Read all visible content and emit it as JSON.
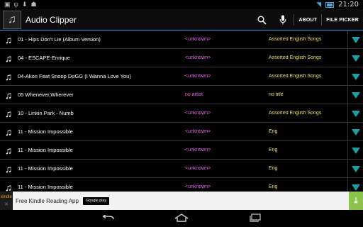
{
  "status": {
    "time": "21:20"
  },
  "app": {
    "title": "Audio Clipper"
  },
  "toolbar": {
    "about_label": "ABOUT",
    "file_picker_label": "FILE PICKER"
  },
  "songs": [
    {
      "title": "01 - Hips Don't Lie (Album Version)",
      "artist": "<unknown>",
      "album": "Assorted English Songs"
    },
    {
      "title": "04 - ESCAPE-Enrique",
      "artist": "<unknown>",
      "album": "Assorted English Songs"
    },
    {
      "title": "04-Akon Feat Snoop DoGG (I Wanna Love You)",
      "artist": "<unknown>",
      "album": "Assorted English Songs"
    },
    {
      "title": "05 Whenever,Wherever",
      "artist": "no artist",
      "album": "no title"
    },
    {
      "title": "10 - Linkin Park - Numb",
      "artist": "<unknown>",
      "album": "Assorted English Songs"
    },
    {
      "title": "11 - Mission Impossible",
      "artist": "<unknown>",
      "album": "Eng"
    },
    {
      "title": "11 - Mission Impossible",
      "artist": "<unknown>",
      "album": "Eng"
    },
    {
      "title": "11 - Mission Impossible",
      "artist": "<unknown>",
      "album": "Eng"
    },
    {
      "title": "11 - Mission Impossible",
      "artist": "<unknown>",
      "album": "Eng"
    }
  ],
  "ad": {
    "logo_text": "kindle",
    "text": "Free Kindle Reading App",
    "store_badge": "Google play"
  },
  "icons": {
    "song": "music-note-icon",
    "download": "download-triangle-icon"
  },
  "colors": {
    "accent": "#2a9fd6",
    "artist": "#ee66ee",
    "album": "#f0e060",
    "download": "#18a0a8"
  }
}
